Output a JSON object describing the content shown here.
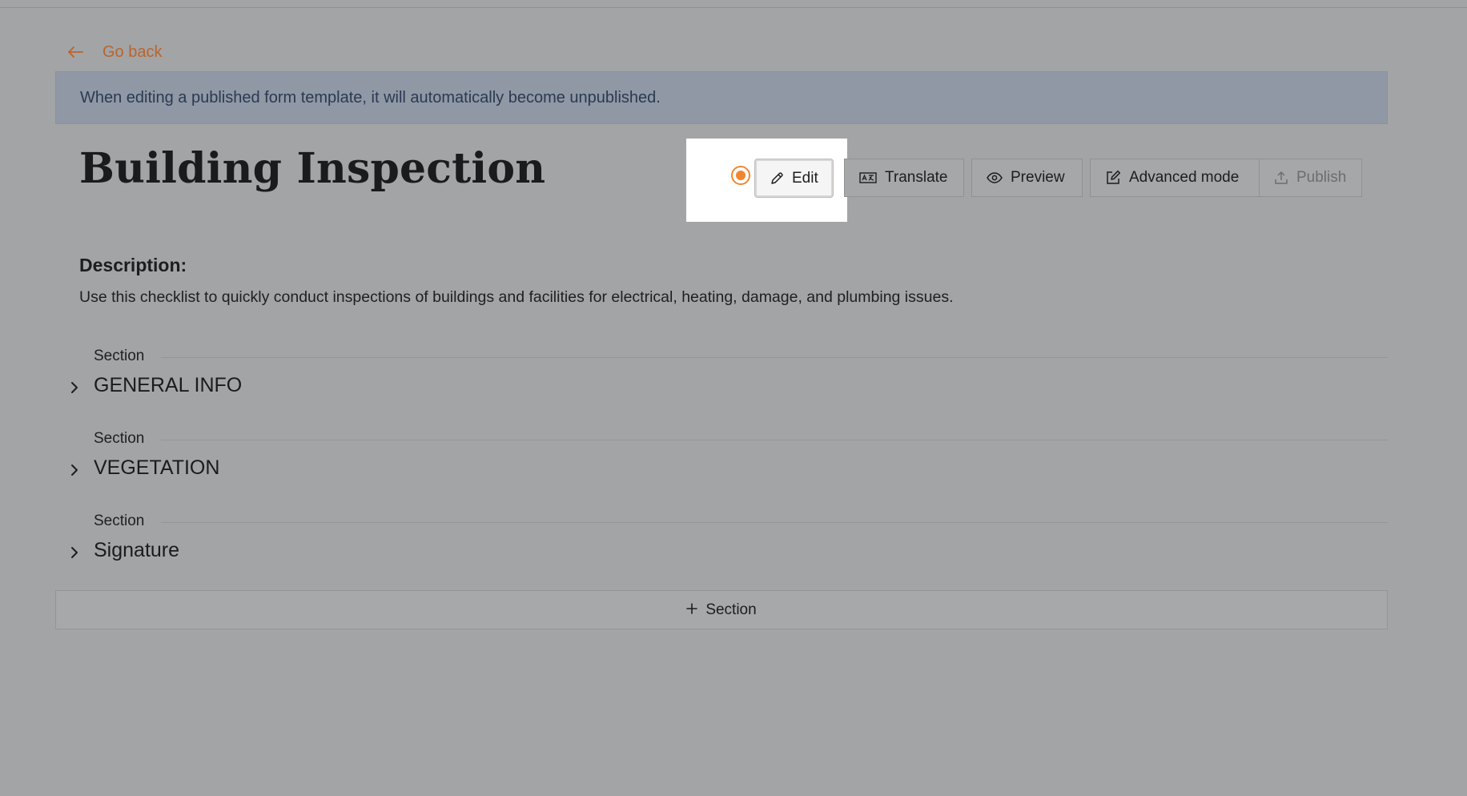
{
  "nav": {
    "back_label": "Go back"
  },
  "banner": {
    "text": "When editing a published form template, it will automatically become unpublished."
  },
  "page": {
    "title": "Building Inspection"
  },
  "toolbar": {
    "edit_label": "Edit",
    "translate_label": "Translate",
    "preview_label": "Preview",
    "advanced_label": "Advanced mode",
    "publish_label": "Publish"
  },
  "description": {
    "label": "Description:",
    "text": "Use this checklist to quickly conduct inspections of buildings and facilities for electrical, heating, damage, and plumbing issues."
  },
  "sections": [
    {
      "kind": "Section",
      "title": "GENERAL INFO"
    },
    {
      "kind": "Section",
      "title": "VEGETATION"
    },
    {
      "kind": "Section",
      "title": "Signature"
    }
  ],
  "add_section": {
    "label": "Section"
  },
  "colors": {
    "accent": "#f2862e",
    "link": "#b9652c",
    "banner_text": "#2a3a52"
  },
  "icons": {
    "back": "arrow-left-icon",
    "edit": "pencil-icon",
    "translate": "translate-icon",
    "preview": "eye-icon",
    "advanced": "edit-square-icon",
    "publish": "upload-icon",
    "expand": "chevron-right-icon",
    "add": "plus-icon"
  }
}
